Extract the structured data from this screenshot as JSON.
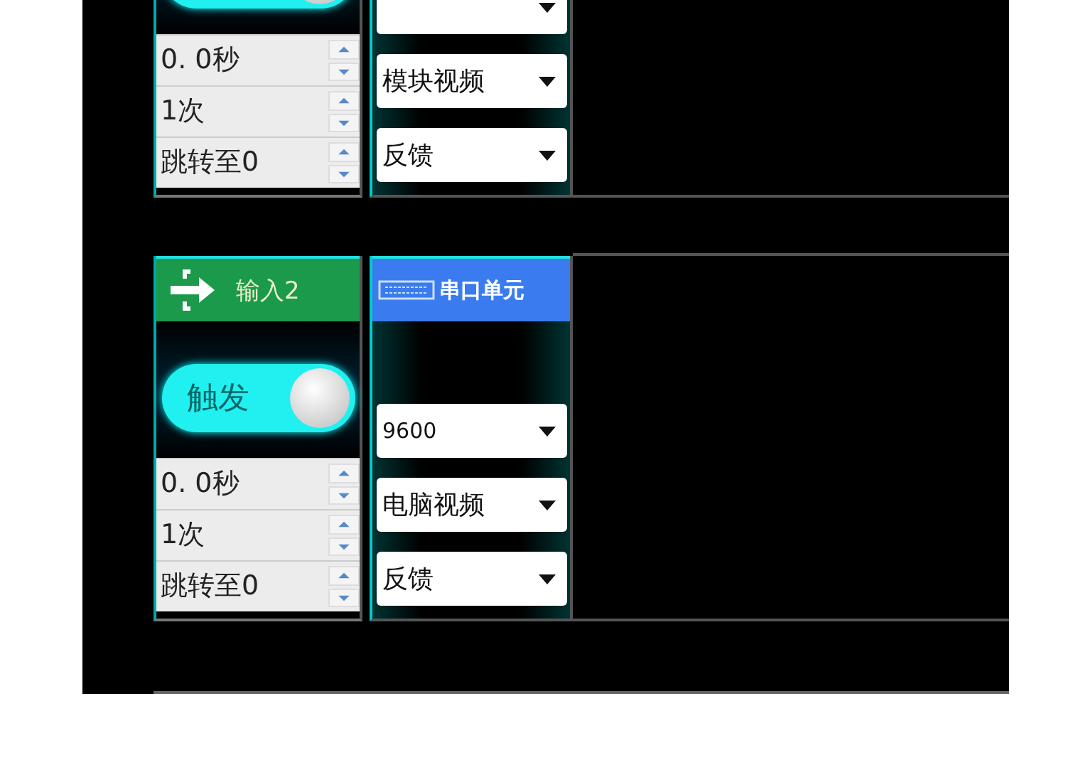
{
  "units": [
    {
      "toggle": {
        "on": true
      },
      "spinners": [
        "0. 0秒",
        "1次",
        "跳转至0"
      ],
      "dropdowns": [
        {
          "kind": "cut"
        },
        {
          "kind": "select",
          "value": "模块视频"
        },
        {
          "kind": "select",
          "value": "反馈"
        }
      ]
    },
    {
      "input_header": {
        "label": "输入2"
      },
      "toggle": {
        "label": "触发",
        "on": true
      },
      "spinners": [
        "0. 0秒",
        "1次",
        "跳转至0"
      ],
      "serial_header": {
        "label": "串口单元"
      },
      "dropdowns": [
        {
          "kind": "select",
          "value": "9600"
        },
        {
          "kind": "select",
          "value": "电脑视频"
        },
        {
          "kind": "select",
          "value": "反馈"
        }
      ]
    }
  ]
}
